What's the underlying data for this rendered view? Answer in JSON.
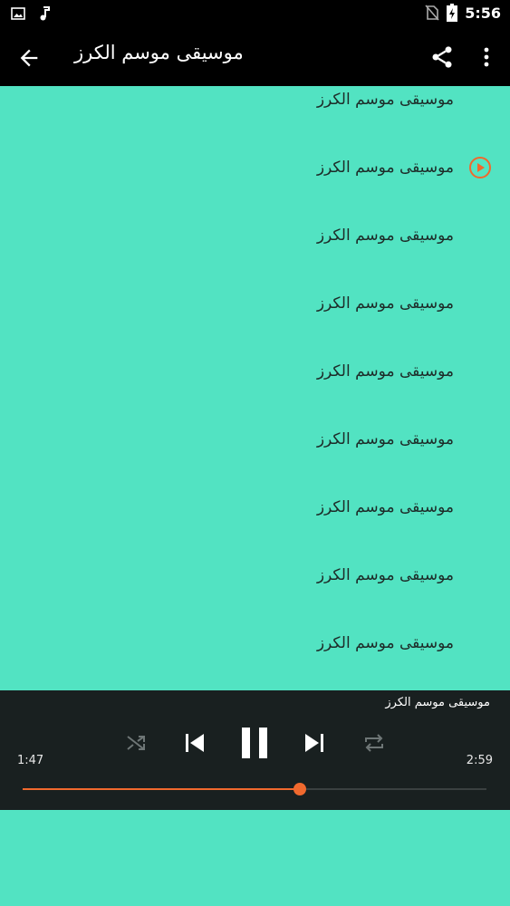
{
  "status_bar": {
    "time": "5:56",
    "icons": [
      "image-icon",
      "music-note-icon",
      "no-sim-icon",
      "battery-charging-icon"
    ]
  },
  "app_bar": {
    "title": "موسيقى موسم الكرز",
    "back_icon": "arrow-left-icon",
    "share_icon": "share-icon",
    "more_icon": "more-vert-icon"
  },
  "list": {
    "items": [
      {
        "label": "موسيقى موسم الكرز",
        "playing": false
      },
      {
        "label": "موسيقى موسم الكرز",
        "playing": true
      },
      {
        "label": "موسيقى موسم الكرز",
        "playing": false
      },
      {
        "label": "موسيقى موسم الكرز",
        "playing": false
      },
      {
        "label": "موسيقى موسم الكرز",
        "playing": false
      },
      {
        "label": "موسيقى موسم الكرز",
        "playing": false
      },
      {
        "label": "موسيقى موسم الكرز",
        "playing": false
      },
      {
        "label": "موسيقى موسم الكرز",
        "playing": false
      },
      {
        "label": "موسيقى موسم الكرز",
        "playing": false
      }
    ]
  },
  "player": {
    "title": "موسيقى موسم الكرز",
    "elapsed": "1:47",
    "duration": "2:59",
    "progress_fraction": 0.598,
    "controls": [
      "shuffle-icon",
      "skip-previous-icon",
      "pause-icon",
      "skip-next-icon",
      "repeat-icon"
    ]
  },
  "colors": {
    "background": "#52e3c2",
    "accent": "#f0692e",
    "bar": "#000000",
    "player": "#192020"
  }
}
